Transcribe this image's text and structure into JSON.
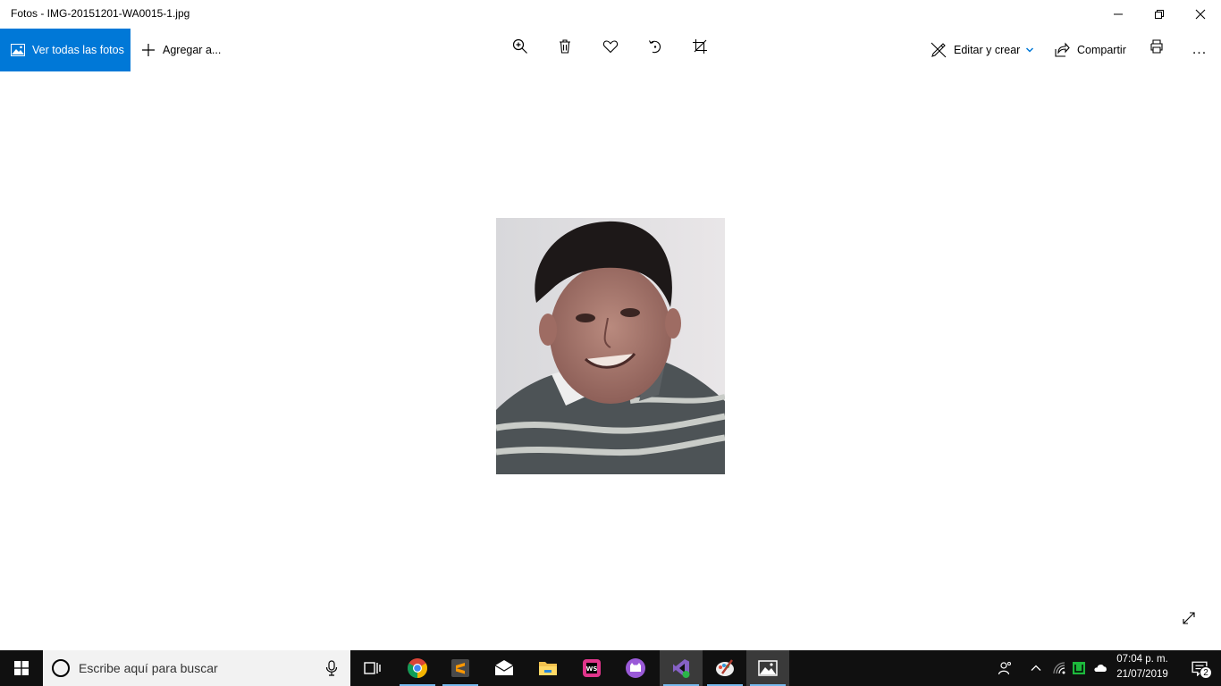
{
  "window": {
    "title": "Fotos - IMG-20151201-WA0015-1.jpg"
  },
  "window_controls": [
    "minimize-icon",
    "restore-icon",
    "close-icon"
  ],
  "toolbar": {
    "view_all_label": "Ver todas las fotos",
    "add_to_label": "Agregar a...",
    "tools": [
      "zoom-in-icon",
      "trash-icon",
      "heart-icon",
      "rotate-icon",
      "crop-icon"
    ],
    "edit_create_label": "Editar y crear",
    "share_label": "Compartir",
    "print_icon": "printer-icon",
    "more_label": "..."
  },
  "colors": {
    "accent": "#0078d7",
    "taskbar": "#101010"
  },
  "taskbar": {
    "search_placeholder": "Escribe aquí para buscar",
    "apps": [
      "task-view-icon",
      "chrome-icon",
      "sublime-text-icon",
      "mail-icon",
      "file-explorer-icon",
      "webstorm-icon",
      "github-desktop-icon",
      "visual-studio-icon",
      "paint-icon",
      "photos-icon"
    ],
    "time": "07:04 p. m.",
    "date": "21/07/2019",
    "notification_count": "2"
  }
}
